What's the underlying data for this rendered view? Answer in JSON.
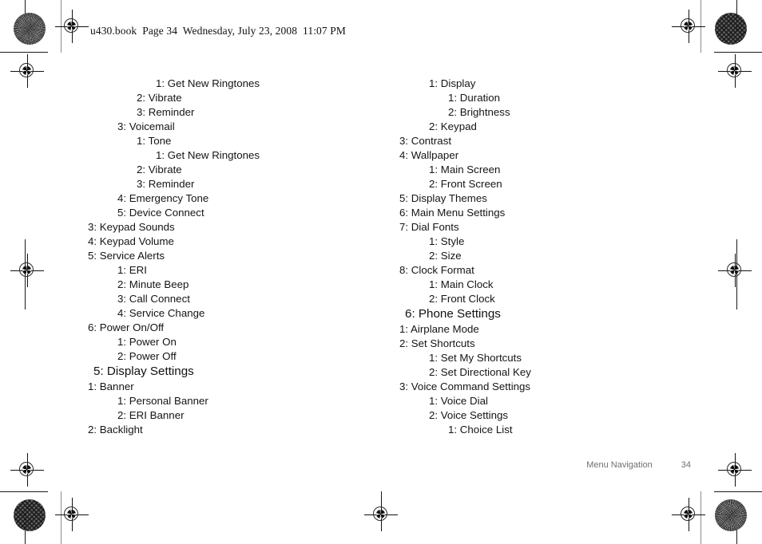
{
  "document": {
    "header_line": "u430.book  Page 34  Wednesday, July 23, 2008  11:07 PM",
    "footer_section": "Menu Navigation",
    "footer_page_number": "34"
  },
  "columns": {
    "left": [
      {
        "label": "1: Get New Ringtones",
        "level": 3,
        "heading": false
      },
      {
        "label": "2: Vibrate",
        "level": 2,
        "heading": false
      },
      {
        "label": "3: Reminder",
        "level": 2,
        "heading": false
      },
      {
        "label": "3: Voicemail",
        "level": 1,
        "heading": false
      },
      {
        "label": "1: Tone",
        "level": 2,
        "heading": false
      },
      {
        "label": "1: Get New Ringtones",
        "level": 3,
        "heading": false
      },
      {
        "label": "2: Vibrate",
        "level": 2,
        "heading": false
      },
      {
        "label": "3: Reminder",
        "level": 2,
        "heading": false
      },
      {
        "label": "4: Emergency Tone",
        "level": 1,
        "heading": false
      },
      {
        "label": "5: Device Connect",
        "level": 1,
        "heading": false
      },
      {
        "label": "3: Keypad Sounds",
        "level": 0,
        "heading": false
      },
      {
        "label": "4: Keypad Volume",
        "level": 0,
        "heading": false
      },
      {
        "label": "5: Service Alerts",
        "level": 0,
        "heading": false
      },
      {
        "label": "1: ERI",
        "level": 1,
        "heading": false
      },
      {
        "label": "2: Minute Beep",
        "level": 1,
        "heading": false
      },
      {
        "label": "3: Call Connect",
        "level": 1,
        "heading": false
      },
      {
        "label": "4: Service Change",
        "level": 1,
        "heading": false
      },
      {
        "label": "6: Power On/Off",
        "level": 0,
        "heading": false
      },
      {
        "label": "1: Power On",
        "level": 1,
        "heading": false
      },
      {
        "label": "2: Power Off",
        "level": 1,
        "heading": false
      },
      {
        "label": "5: Display Settings",
        "level": 0,
        "heading": true
      },
      {
        "label": "1: Banner",
        "level": 0,
        "heading": false
      },
      {
        "label": "1: Personal Banner",
        "level": 1,
        "heading": false
      },
      {
        "label": "2: ERI Banner",
        "level": 1,
        "heading": false
      },
      {
        "label": "2: Backlight",
        "level": 0,
        "heading": false
      }
    ],
    "right": [
      {
        "label": "1: Display",
        "level": 1,
        "heading": false
      },
      {
        "label": "1: Duration",
        "level": 2,
        "heading": false
      },
      {
        "label": "2: Brightness",
        "level": 2,
        "heading": false
      },
      {
        "label": "2: Keypad",
        "level": 1,
        "heading": false
      },
      {
        "label": "3: Contrast",
        "level": 0,
        "heading": false
      },
      {
        "label": "4: Wallpaper",
        "level": 0,
        "heading": false
      },
      {
        "label": "1: Main Screen",
        "level": 1,
        "heading": false
      },
      {
        "label": "2: Front Screen",
        "level": 1,
        "heading": false
      },
      {
        "label": "5: Display Themes",
        "level": 0,
        "heading": false
      },
      {
        "label": "6: Main Menu Settings",
        "level": 0,
        "heading": false
      },
      {
        "label": "7: Dial Fonts",
        "level": 0,
        "heading": false
      },
      {
        "label": "1: Style",
        "level": 1,
        "heading": false
      },
      {
        "label": "2: Size",
        "level": 1,
        "heading": false
      },
      {
        "label": "8: Clock Format",
        "level": 0,
        "heading": false
      },
      {
        "label": "1: Main Clock",
        "level": 1,
        "heading": false
      },
      {
        "label": "2: Front Clock",
        "level": 1,
        "heading": false
      },
      {
        "label": "6: Phone Settings",
        "level": 0,
        "heading": true
      },
      {
        "label": "1: Airplane Mode",
        "level": 0,
        "heading": false
      },
      {
        "label": "2: Set Shortcuts",
        "level": 0,
        "heading": false
      },
      {
        "label": "1: Set My Shortcuts",
        "level": 1,
        "heading": false
      },
      {
        "label": "2: Set Directional Key",
        "level": 1,
        "heading": false
      },
      {
        "label": "3: Voice Command Settings",
        "level": 0,
        "heading": false
      },
      {
        "label": "1: Voice Dial",
        "level": 1,
        "heading": false
      },
      {
        "label": "2: Voice Settings",
        "level": 1,
        "heading": false
      },
      {
        "label": "1: Choice List",
        "level": 2,
        "heading": false
      }
    ]
  }
}
